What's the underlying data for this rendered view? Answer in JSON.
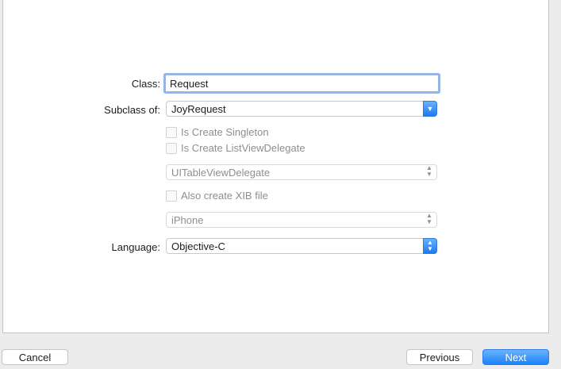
{
  "form": {
    "class_label": "Class:",
    "class_value": "Request",
    "subclass_label": "Subclass of:",
    "subclass_value": "JoyRequest",
    "singleton_label": "Is Create Singleton",
    "listview_label": "Is Create ListViewDelegate",
    "delegate_value": "UITableViewDelegate",
    "xib_label": "Also create XIB file",
    "device_value": "iPhone",
    "language_label": "Language:",
    "language_value": "Objective-C"
  },
  "footer": {
    "cancel_label": "Cancel",
    "previous_label": "Previous",
    "next_label": "Next"
  },
  "icons": {
    "dropdown": "chevron-down-icon",
    "stepper": "up-down-stepper-icon"
  },
  "colors": {
    "accent": "#1a82fb",
    "disabled_text": "#8e8e8e",
    "focus_ring": "#8eb6f0"
  }
}
